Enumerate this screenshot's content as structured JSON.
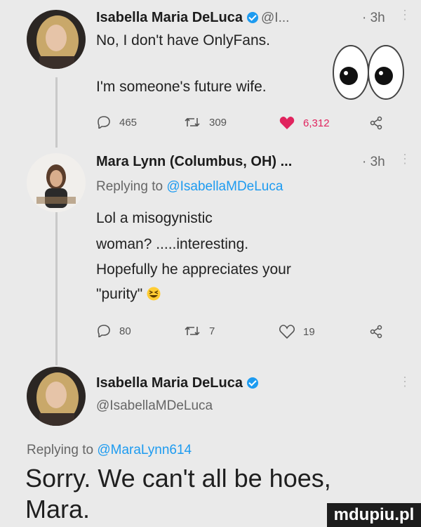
{
  "tweet1": {
    "author": "Isabella Maria DeLuca",
    "handle_trunc": "@I...",
    "time": "· 3h",
    "line1": "No, I don't have OnlyFans.",
    "line2": "I'm someone's future wife.",
    "replies": "465",
    "retweets": "309",
    "likes": "6,312"
  },
  "tweet2": {
    "author": "Mara Lynn (Columbus, OH) ...",
    "time": "· 3h",
    "replying_prefix": "Replying to",
    "replying_handle": "@IsabellaMDeLuca",
    "lines": [
      "Lol a misogynistic",
      "woman? .....interesting.",
      "Hopefully he appreciates your",
      "\"purity\""
    ],
    "replies": "80",
    "retweets": "7",
    "likes": "19"
  },
  "tweet3": {
    "author": "Isabella Maria DeLuca",
    "handle": "@IsabellaMDeLuca",
    "replying_prefix": "Replying to",
    "replying_handle": "@MaraLynn614",
    "line1": "Sorry. We can't all be hoes,",
    "line2": "Mara."
  },
  "icons": {
    "reply": "reply-icon",
    "retweet": "retweet-icon",
    "like": "heart-icon",
    "share": "share-icon",
    "verified": "verified-badge-icon",
    "more": "more-icon",
    "eyes": "eyes-emoji",
    "grin": "grinning-squinting-emoji"
  },
  "colors": {
    "link": "#1d9bf0",
    "liked_heart": "#e0245e",
    "background": "#eaeaea"
  },
  "watermark": "mdupiu.pl"
}
